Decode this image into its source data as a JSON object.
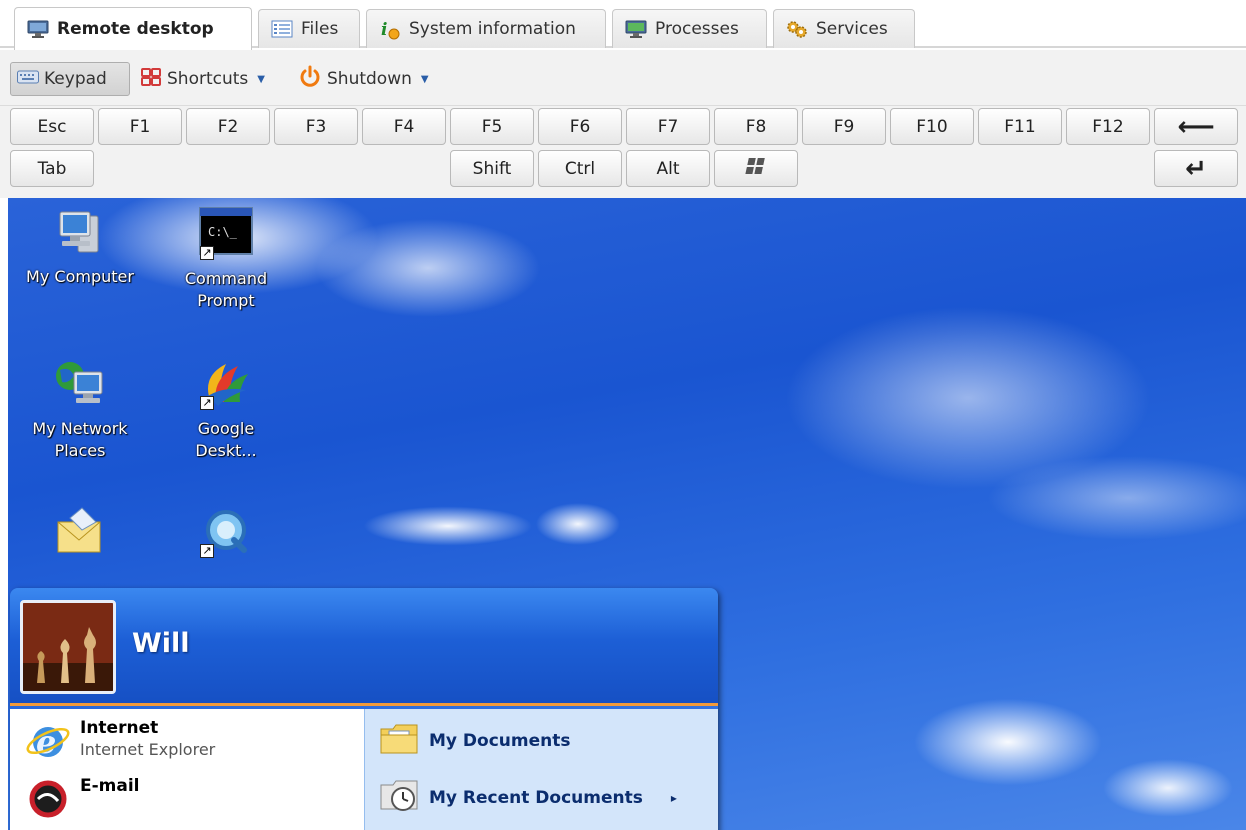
{
  "tabs": [
    {
      "label": "Remote desktop",
      "icon": "monitor-icon",
      "active": true
    },
    {
      "label": "Files",
      "icon": "list-icon",
      "active": false
    },
    {
      "label": "System information",
      "icon": "info-icon",
      "active": false
    },
    {
      "label": "Processes",
      "icon": "processes-icon",
      "active": false
    },
    {
      "label": "Services",
      "icon": "gears-icon",
      "active": false
    }
  ],
  "toolbar": {
    "keypad_label": "Keypad",
    "shortcuts_label": "Shortcuts",
    "shutdown_label": "Shutdown"
  },
  "keys": {
    "row1": [
      "Esc",
      "F1",
      "F2",
      "F3",
      "F4",
      "F5",
      "F6",
      "F7",
      "F8",
      "F9",
      "F10",
      "F11",
      "F12"
    ],
    "backspace_glyph": "⟵",
    "tab": "Tab",
    "shift": "Shift",
    "ctrl": "Ctrl",
    "alt": "Alt",
    "enter_glyph": "↵"
  },
  "desktop": {
    "icons": [
      {
        "label_lines": [
          "My Computer"
        ],
        "icon": "my-computer-icon"
      },
      {
        "label_lines": [
          "Command",
          "Prompt"
        ],
        "icon": "command-prompt-icon",
        "glyph": "C:\\_"
      },
      {
        "label_lines": [
          "My Network",
          "Places"
        ],
        "icon": "network-places-icon"
      },
      {
        "label_lines": [
          "Google",
          "Deskt..."
        ],
        "icon": "google-desktop-icon"
      }
    ]
  },
  "start_menu": {
    "username": "Will",
    "left_items": [
      {
        "title": "Internet",
        "subtitle": "Internet Explorer",
        "icon": "internet-explorer-icon"
      },
      {
        "title": "E-mail",
        "subtitle": "",
        "icon": "email-icon"
      }
    ],
    "right_items": [
      {
        "label": "My Documents",
        "icon": "my-documents-icon"
      },
      {
        "label": "My Recent Documents",
        "icon": "recent-documents-icon",
        "arrow": "▸"
      }
    ]
  },
  "colors": {
    "desktop_blue": "#1a55d1",
    "start_header": "#1d5fd6",
    "start_accent": "#f39a3a",
    "start_right_pane": "#d3e5fa"
  }
}
